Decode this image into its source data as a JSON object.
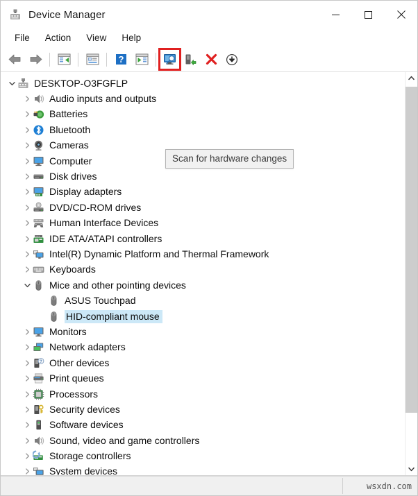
{
  "window": {
    "title": "Device Manager",
    "icon": "device-manager-icon",
    "controls": {
      "minimize": "minimize-icon",
      "maximize": "maximize-icon",
      "close": "close-icon"
    }
  },
  "menubar": {
    "items": [
      {
        "label": "File"
      },
      {
        "label": "Action"
      },
      {
        "label": "View"
      },
      {
        "label": "Help"
      }
    ]
  },
  "toolbar": {
    "buttons": [
      {
        "name": "back-button",
        "icon": "back-arrow-icon"
      },
      {
        "name": "forward-button",
        "icon": "forward-arrow-icon"
      },
      {
        "name": "separator-1",
        "icon": "separator"
      },
      {
        "name": "show-hide-console-tree-button",
        "icon": "console-tree-icon"
      },
      {
        "name": "separator-2",
        "icon": "separator"
      },
      {
        "name": "properties-button",
        "icon": "properties-window-icon"
      },
      {
        "name": "separator-3",
        "icon": "separator"
      },
      {
        "name": "help-button",
        "icon": "help-question-icon"
      },
      {
        "name": "show-window-button",
        "icon": "window-play-icon"
      },
      {
        "name": "separator-4",
        "icon": "separator"
      },
      {
        "name": "scan-for-hardware-changes-button",
        "icon": "scan-monitor-magnifier-icon",
        "highlighted": true
      },
      {
        "name": "update-driver-button",
        "icon": "update-driver-icon"
      },
      {
        "name": "uninstall-device-button",
        "icon": "red-x-icon"
      },
      {
        "name": "disable-device-button",
        "icon": "down-arrow-circle-icon"
      }
    ]
  },
  "tooltip": {
    "text": "Scan for hardware changes",
    "visible": true
  },
  "tree": {
    "rows": [
      {
        "label": "DESKTOP-O3FGFLP",
        "level": 0,
        "expander": "expanded",
        "icon": "computer-root-icon",
        "selected": false
      },
      {
        "label": "Audio inputs and outputs",
        "level": 1,
        "expander": "collapsed",
        "icon": "speaker-icon",
        "selected": false
      },
      {
        "label": "Batteries",
        "level": 1,
        "expander": "collapsed",
        "icon": "battery-icon",
        "selected": false
      },
      {
        "label": "Bluetooth",
        "level": 1,
        "expander": "collapsed",
        "icon": "bluetooth-icon",
        "selected": false
      },
      {
        "label": "Cameras",
        "level": 1,
        "expander": "collapsed",
        "icon": "camera-icon",
        "selected": false
      },
      {
        "label": "Computer",
        "level": 1,
        "expander": "collapsed",
        "icon": "monitor-icon",
        "selected": false
      },
      {
        "label": "Disk drives",
        "level": 1,
        "expander": "collapsed",
        "icon": "disk-drive-icon",
        "selected": false
      },
      {
        "label": "Display adapters",
        "level": 1,
        "expander": "collapsed",
        "icon": "display-adapter-icon",
        "selected": false
      },
      {
        "label": "DVD/CD-ROM drives",
        "level": 1,
        "expander": "collapsed",
        "icon": "dvd-drive-icon",
        "selected": false
      },
      {
        "label": "Human Interface Devices",
        "level": 1,
        "expander": "collapsed",
        "icon": "hid-icon",
        "selected": false
      },
      {
        "label": "IDE ATA/ATAPI controllers",
        "level": 1,
        "expander": "collapsed",
        "icon": "ide-controller-icon",
        "selected": false
      },
      {
        "label": "Intel(R) Dynamic Platform and Thermal Framework",
        "level": 1,
        "expander": "collapsed",
        "icon": "thermal-framework-icon",
        "selected": false
      },
      {
        "label": "Keyboards",
        "level": 1,
        "expander": "collapsed",
        "icon": "keyboard-icon",
        "selected": false
      },
      {
        "label": "Mice and other pointing devices",
        "level": 1,
        "expander": "expanded",
        "icon": "mouse-icon",
        "selected": false
      },
      {
        "label": "ASUS Touchpad",
        "level": 2,
        "expander": "none",
        "icon": "mouse-icon",
        "selected": false
      },
      {
        "label": "HID-compliant mouse",
        "level": 2,
        "expander": "none",
        "icon": "mouse-icon",
        "selected": true
      },
      {
        "label": "Monitors",
        "level": 1,
        "expander": "collapsed",
        "icon": "monitor-icon",
        "selected": false
      },
      {
        "label": "Network adapters",
        "level": 1,
        "expander": "collapsed",
        "icon": "network-adapter-icon",
        "selected": false
      },
      {
        "label": "Other devices",
        "level": 1,
        "expander": "collapsed",
        "icon": "other-device-icon",
        "selected": false
      },
      {
        "label": "Print queues",
        "level": 1,
        "expander": "collapsed",
        "icon": "printer-icon",
        "selected": false
      },
      {
        "label": "Processors",
        "level": 1,
        "expander": "collapsed",
        "icon": "processor-icon",
        "selected": false
      },
      {
        "label": "Security devices",
        "level": 1,
        "expander": "collapsed",
        "icon": "security-key-icon",
        "selected": false
      },
      {
        "label": "Software devices",
        "level": 1,
        "expander": "collapsed",
        "icon": "software-device-icon",
        "selected": false
      },
      {
        "label": "Sound, video and game controllers",
        "level": 1,
        "expander": "collapsed",
        "icon": "speaker-icon",
        "selected": false
      },
      {
        "label": "Storage controllers",
        "level": 1,
        "expander": "collapsed",
        "icon": "storage-controller-icon",
        "selected": false
      },
      {
        "label": "System devices",
        "level": 1,
        "expander": "collapsed",
        "icon": "system-device-icon",
        "selected": false
      }
    ]
  },
  "scrollbar": {
    "up_arrow": "scroll-up-icon",
    "down_arrow": "scroll-down-icon"
  },
  "statusbar": {
    "text": "",
    "watermark": "wsxdn.com"
  },
  "colors": {
    "selection": "#cce8f7",
    "highlight_box": "#e02020",
    "tooltip_bg": "#f1f1f1",
    "statusbar_bg": "#f0f0f0"
  }
}
